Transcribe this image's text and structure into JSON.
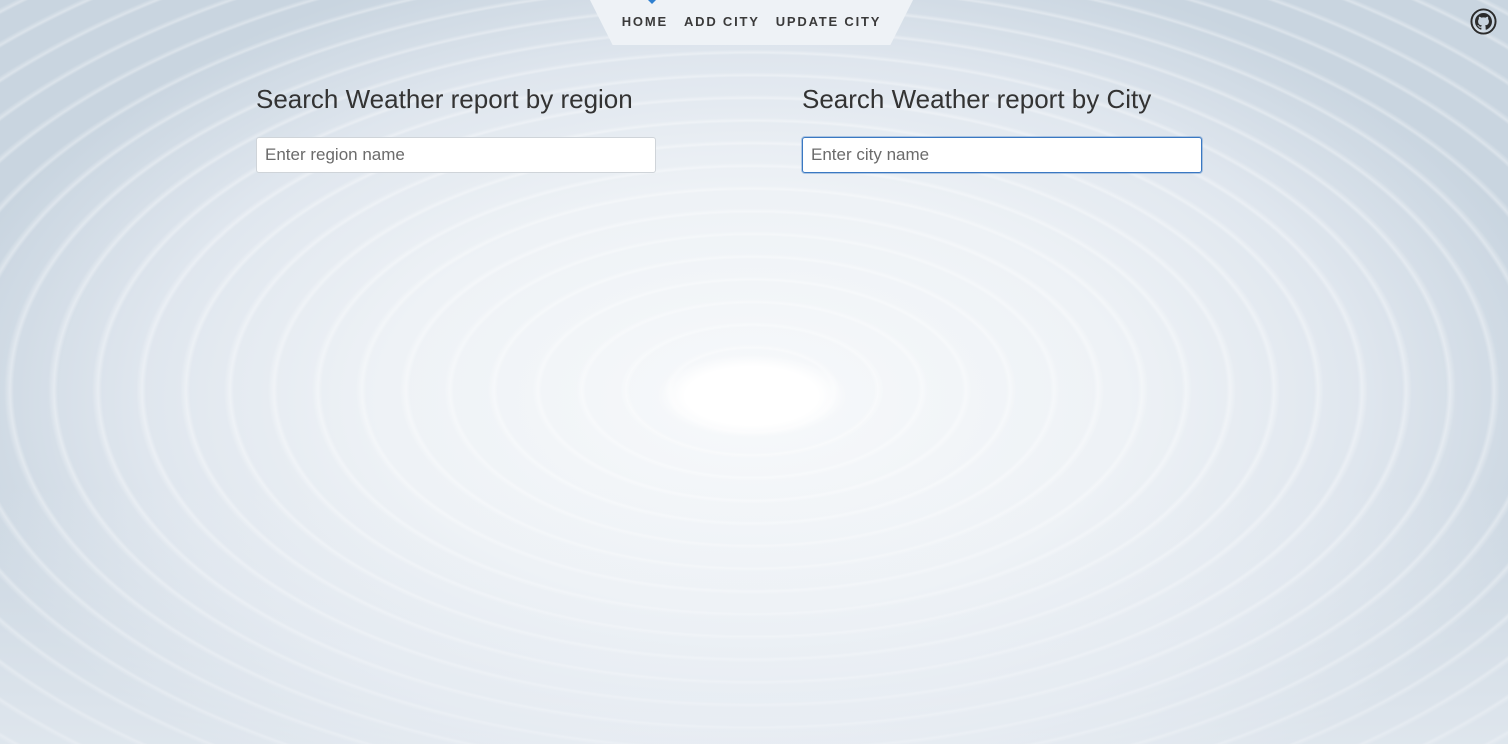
{
  "nav": {
    "items": [
      {
        "label": "HOME"
      },
      {
        "label": "ADD CITY"
      },
      {
        "label": "UPDATE CITY"
      }
    ],
    "active_index": 0,
    "accent_color": "#2f80d0"
  },
  "github": {
    "icon": "github-icon"
  },
  "region_search": {
    "heading": "Search Weather report by region",
    "placeholder": "Enter region name",
    "value": ""
  },
  "city_search": {
    "heading": "Search Weather report by City",
    "placeholder": "Enter city name",
    "value": "",
    "focused": true
  }
}
